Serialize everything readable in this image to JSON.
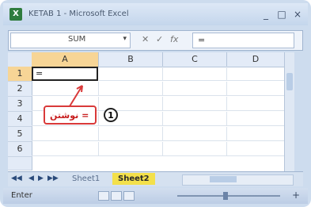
{
  "window": {
    "title": "KETAB 1 - Microsoft Excel",
    "minimize": "_",
    "maximize": "□",
    "close": "×"
  },
  "formula_bar": {
    "name_box_value": "SUM",
    "cancel_icon": "✕",
    "enter_icon": "✓",
    "fx_label": "fx",
    "formula_value": "="
  },
  "grid": {
    "columns": [
      "A",
      "B",
      "C",
      "D"
    ],
    "rows": [
      "1",
      "2",
      "3",
      "4",
      "5",
      "6"
    ],
    "active_cell_value": "="
  },
  "sheet_tabs": {
    "tabs": [
      "Sheet1",
      "Sheet2"
    ],
    "active": "Sheet2"
  },
  "status_bar": {
    "mode": "Enter",
    "zoom_plus": "+"
  },
  "annotation": {
    "label": "نوشتن =",
    "number": "1"
  }
}
